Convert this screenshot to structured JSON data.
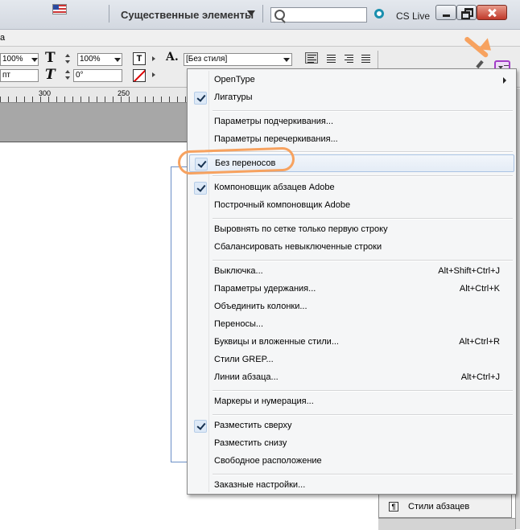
{
  "titlebar": {
    "workspace_label": "Существенные элементы",
    "search_placeholder": "",
    "cslive_label": "CS Live"
  },
  "menustrip": {
    "fragment": "а"
  },
  "control_panel": {
    "field1_value": "100%",
    "field2_value": "100%",
    "field3_value": "пт",
    "field4_value": "0°",
    "paragraph_style_value": "[Без стиля]"
  },
  "ruler": {
    "label_300": "300",
    "label_250": "250"
  },
  "styles_panel": {
    "label": "Стили абзацев",
    "icon_glyph": "¶"
  },
  "dropdown": {
    "items": [
      {
        "label": "OpenType",
        "shortcut": "",
        "checked": false,
        "submenu": true
      },
      {
        "label": "Лигатуры",
        "shortcut": "",
        "checked": true,
        "submenu": false
      },
      {
        "label": "Параметры подчеркивания...",
        "shortcut": "",
        "checked": false,
        "submenu": false
      },
      {
        "label": "Параметры перечеркивания...",
        "shortcut": "",
        "checked": false,
        "submenu": false
      },
      {
        "label": "Без переносов",
        "shortcut": "",
        "checked": true,
        "submenu": false,
        "highlighted": true
      },
      {
        "label": "Компоновщик абзацев Adobe",
        "shortcut": "",
        "checked": true,
        "submenu": false
      },
      {
        "label": "Построчный компоновщик Adobe",
        "shortcut": "",
        "checked": false,
        "submenu": false
      },
      {
        "label": "Выровнять по сетке только первую строку",
        "shortcut": "",
        "checked": false,
        "submenu": false
      },
      {
        "label": "Сбалансировать невыключенные строки",
        "shortcut": "",
        "checked": false,
        "submenu": false
      },
      {
        "label": "Выключка...",
        "shortcut": "Alt+Shift+Ctrl+J",
        "checked": false,
        "submenu": false
      },
      {
        "label": "Параметры удержания...",
        "shortcut": "Alt+Ctrl+K",
        "checked": false,
        "submenu": false
      },
      {
        "label": "Объединить колонки...",
        "shortcut": "",
        "checked": false,
        "submenu": false
      },
      {
        "label": "Переносы...",
        "shortcut": "",
        "checked": false,
        "submenu": false
      },
      {
        "label": "Буквицы и вложенные стили...",
        "shortcut": "Alt+Ctrl+R",
        "checked": false,
        "submenu": false
      },
      {
        "label": "Стили GREP...",
        "shortcut": "",
        "checked": false,
        "submenu": false
      },
      {
        "label": "Линии абзаца...",
        "shortcut": "Alt+Ctrl+J",
        "checked": false,
        "submenu": false
      },
      {
        "label": "Маркеры и нумерация...",
        "shortcut": "",
        "checked": false,
        "submenu": false
      },
      {
        "label": "Разместить сверху",
        "shortcut": "",
        "checked": true,
        "submenu": false
      },
      {
        "label": "Разместить снизу",
        "shortcut": "",
        "checked": false,
        "submenu": false
      },
      {
        "label": "Свободное расположение",
        "shortcut": "",
        "checked": false,
        "submenu": false
      },
      {
        "label": "Заказные настройки...",
        "shortcut": "",
        "checked": false,
        "submenu": false
      }
    ]
  },
  "colors": {
    "annotation": "#f7a25f",
    "highlight_border": "#a9c3e4",
    "panel_menu_button": "#a23cc7"
  }
}
